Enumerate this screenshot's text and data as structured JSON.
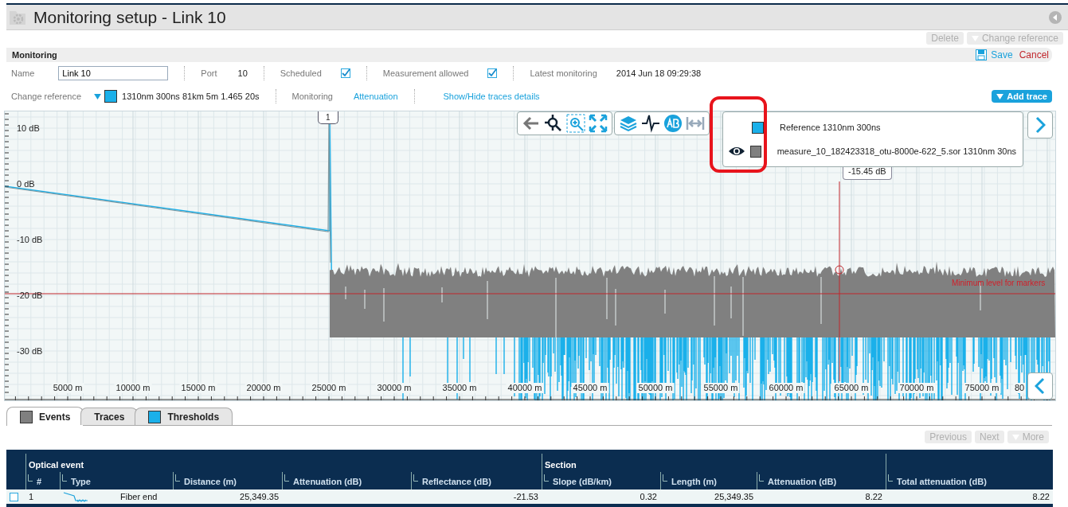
{
  "window": {
    "title": "Monitoring setup - Link 10"
  },
  "top_actions": [
    {
      "label": "Delete",
      "disabled": true,
      "kind": "plain"
    },
    {
      "label": "Change reference",
      "disabled": true,
      "kind": "dropdown"
    }
  ],
  "section": {
    "title": "Monitoring",
    "actions": [
      {
        "label": "Save",
        "kind": "save"
      },
      {
        "label": "Cancel",
        "kind": "cancel"
      }
    ]
  },
  "form": {
    "name_label": "Name",
    "name_value": "Link 10",
    "port_label": "Port",
    "port_value": "10",
    "scheduled_label": "Scheduled",
    "scheduled_checked": true,
    "measurement_label": "Measurement allowed",
    "measurement_checked": true,
    "latest_label": "Latest monitoring",
    "latest_value": "2014 Jun 18 09:29:38"
  },
  "reference_row": {
    "label": "Change reference",
    "reference_text": "1310nm 300ns 81km 5m 1.465 20s",
    "monitoring_label": "Monitoring",
    "monitoring_link": "Attenuation",
    "details_link": "Show/Hide traces details",
    "add_trace": "Add trace"
  },
  "chart": {
    "y_labels": [
      "10 dB",
      "0 dB",
      "-10 dB",
      "-20 dB",
      "-30 dB"
    ],
    "x_labels": [
      "5000 m",
      "10000 m",
      "15000 m",
      "20000 m",
      "25000 m",
      "30000 m",
      "35000 m",
      "40000 m",
      "45000 m",
      "50000 m",
      "55000 m",
      "60000 m",
      "65000 m",
      "70000 m",
      "75000 m",
      "80"
    ],
    "marker_label": "1",
    "cursor_reading": "-15.45 dB",
    "threshold_label": "Minimum level for markers",
    "legend": [
      {
        "label": "Reference 1310nm 300ns",
        "color": "#1ab0ea",
        "visible": false
      },
      {
        "label": "measure_10_182423318_otu-8000e-622_5.sor 1310nm 30ns",
        "color": "#808080",
        "visible": true
      }
    ],
    "legend_highlighted": true
  },
  "tabs": [
    {
      "label": "Events",
      "selected": true,
      "color": "#808080"
    },
    {
      "label": "Traces",
      "selected": false
    },
    {
      "label": "Thresholds",
      "selected": false,
      "color": "#1ab0ea"
    }
  ],
  "pager": [
    {
      "label": "Previous",
      "disabled": true,
      "kind": "plain"
    },
    {
      "label": "Next",
      "disabled": true,
      "kind": "plain"
    },
    {
      "label": "More",
      "disabled": true,
      "kind": "dropdown"
    }
  ],
  "table": {
    "groups": [
      {
        "label": "Optical event",
        "columns": [
          {
            "label": "#",
            "kind": "text"
          },
          {
            "label": "Type",
            "kind": "type"
          },
          {
            "label": "Distance (m)",
            "kind": "number"
          },
          {
            "label": "Attenuation (dB)",
            "kind": "number"
          },
          {
            "label": "Reflectance (dB)",
            "kind": "number"
          }
        ]
      },
      {
        "label": "Section",
        "columns": [
          {
            "label": "Slope (dB/km)",
            "kind": "number"
          },
          {
            "label": "Length (m)",
            "kind": "number"
          },
          {
            "label": "Attenuation (dB)",
            "kind": "number"
          }
        ]
      },
      {
        "columns": [
          {
            "label": "Total attenuation (dB)",
            "kind": "number"
          }
        ]
      }
    ],
    "rows": [
      {
        "checked": false,
        "cells": [
          "1",
          "Fiber end",
          "25,349.35",
          null,
          "-21.53",
          "0.32",
          "25,349.35",
          "8.22",
          "8.22"
        ]
      }
    ]
  }
}
